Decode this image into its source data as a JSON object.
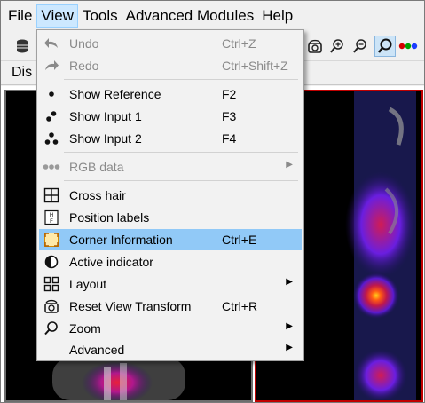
{
  "menubar": {
    "items": [
      "File",
      "View",
      "Tools",
      "Advanced Modules",
      "Help"
    ],
    "active": "View"
  },
  "panel": {
    "tab_label": "Dis"
  },
  "view_menu": {
    "items": [
      {
        "label": "Undo",
        "shortcut": "Ctrl+Z",
        "icon": "undo-icon",
        "disabled": true
      },
      {
        "label": "Redo",
        "shortcut": "Ctrl+Shift+Z",
        "icon": "redo-icon",
        "disabled": true
      },
      {
        "label": "Show Reference",
        "shortcut": "F2",
        "icon": "one-dot-icon"
      },
      {
        "label": "Show Input 1",
        "shortcut": "F3",
        "icon": "two-dots-icon"
      },
      {
        "label": "Show Input 2",
        "shortcut": "F4",
        "icon": "three-dots-icon"
      },
      {
        "label": "RGB data",
        "icon": "rgb-dots-icon",
        "disabled": true,
        "submenu": true
      },
      {
        "label": "Cross hair",
        "icon": "crosshair-grid-icon"
      },
      {
        "label": "Position labels",
        "icon": "position-labels-icon"
      },
      {
        "label": "Corner Information",
        "shortcut": "Ctrl+E",
        "icon": "corner-info-icon",
        "highlighted": true
      },
      {
        "label": "Active indicator",
        "icon": "active-indicator-icon"
      },
      {
        "label": "Layout",
        "icon": "layout-grid-icon",
        "submenu": true
      },
      {
        "label": "Reset View Transform",
        "shortcut": "Ctrl+R",
        "icon": "reset-view-icon"
      },
      {
        "label": "Zoom",
        "icon": "zoom-icon",
        "submenu": true
      },
      {
        "label": "Advanced",
        "submenu": true
      }
    ]
  },
  "colors": {
    "menu_highlight": "#91c9f7",
    "menubar_active": "#cce8ff",
    "right_view_border": "#c00000"
  }
}
